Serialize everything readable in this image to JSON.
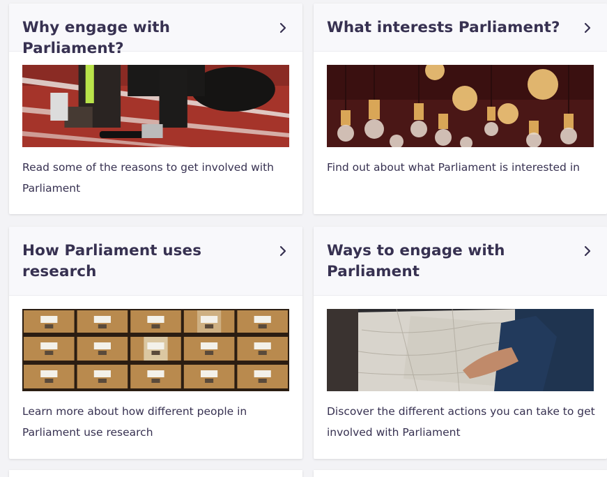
{
  "cards": [
    {
      "title": "Why engage with Parliament?",
      "description": "Read some of the reasons to get involved with Parliament",
      "image": "running-track-sprinter-image"
    },
    {
      "title": "What interests Parliament?",
      "description": "Find out about what Parliament is interested in",
      "image": "light-bulbs-image"
    },
    {
      "title": "How Parliament uses research",
      "description": "Learn more about how different people in Parliament use research",
      "image": "card-catalogue-drawers-image"
    },
    {
      "title": "Ways to engage with Parliament",
      "description": "Discover the different actions you can take to get involved with Parliament",
      "image": "map-pointing-image"
    }
  ],
  "colors": {
    "text": "#373151",
    "header_bg": "#f8f8fb",
    "page_bg": "#f3f3f6"
  },
  "icons": {
    "chevron": "chevron-right-icon"
  }
}
